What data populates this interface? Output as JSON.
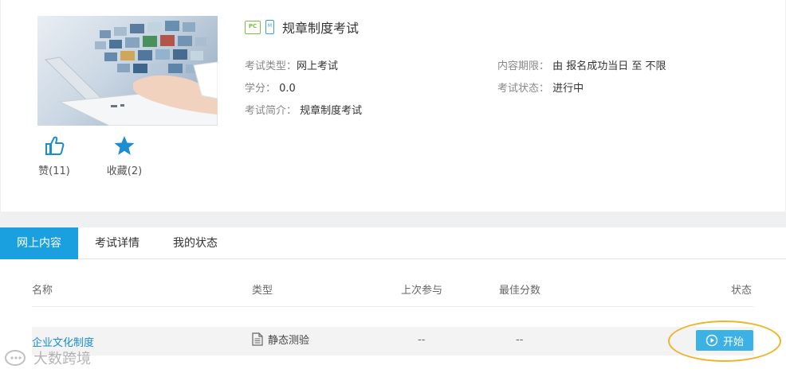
{
  "course": {
    "title": "规章制度考试",
    "badge_pc": "PC",
    "badge_mobile": "M",
    "meta": {
      "type_label": "考试类型：",
      "type_value": "网上考试",
      "credit_label": "学分：",
      "credit_value": "0.0",
      "intro_label": "考试简介：",
      "intro_value": "规章制度考试",
      "period_label": "内容期限：",
      "period_value": "由 报名成功当日 至 不限",
      "status_label": "考试状态：",
      "status_value": "进行中"
    },
    "actions": {
      "like": "赞(11)",
      "favorite": "收藏(2)"
    }
  },
  "tabs": [
    {
      "label": "网上内容",
      "active": true
    },
    {
      "label": "考试详情",
      "active": false
    },
    {
      "label": "我的状态",
      "active": false
    }
  ],
  "table": {
    "headers": {
      "name": "名称",
      "type": "类型",
      "last": "上次参与",
      "best": "最佳分数",
      "status": "状态"
    },
    "rows": [
      {
        "name": "企业文化制度",
        "type": "静态测验",
        "last": "--",
        "best": "--",
        "action": "开始"
      }
    ]
  },
  "watermark": "大数跨境",
  "colors": {
    "accent": "#1aa0de",
    "button": "#3cb1e6",
    "link": "#1a8ed0",
    "highlight": "#f0b429"
  },
  "icons": {
    "like": "thumbs-up-icon",
    "favorite": "star-icon",
    "doc": "document-icon",
    "play": "play-circle-icon"
  }
}
